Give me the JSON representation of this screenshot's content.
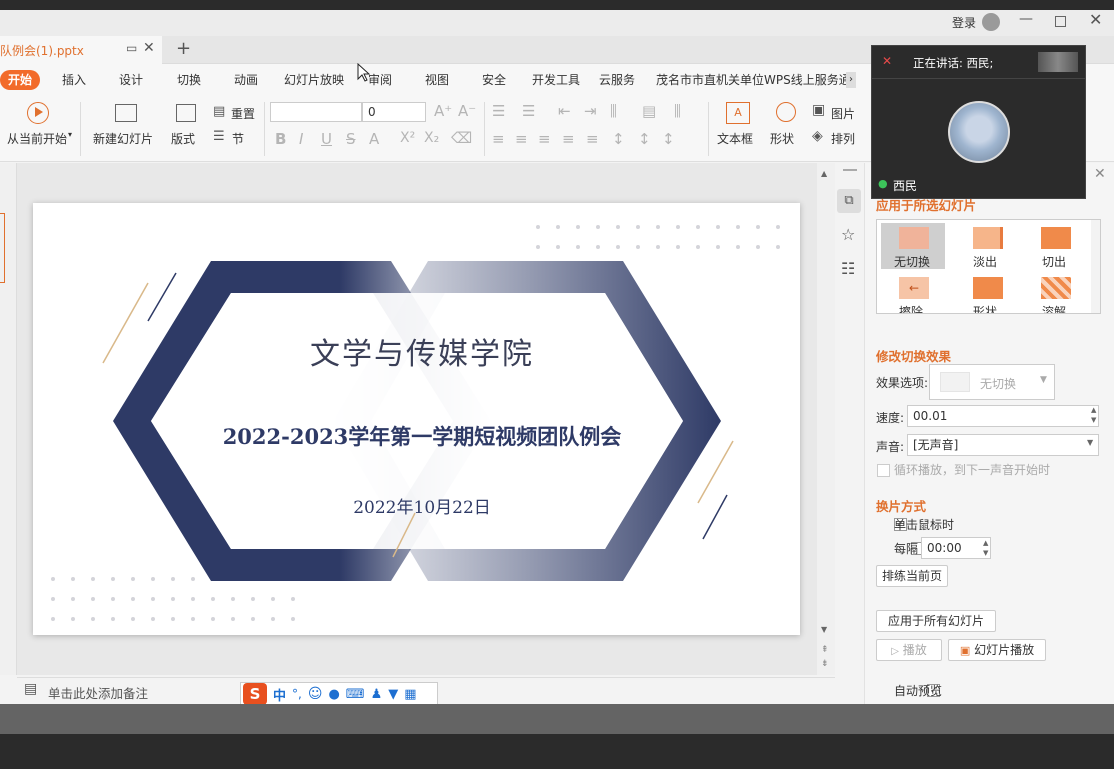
{
  "titlebar": {
    "login": "登录"
  },
  "doc_tab": {
    "title": "队例会(1).pptx"
  },
  "menu": {
    "items": [
      "开始",
      "插入",
      "设计",
      "切换",
      "动画",
      "幻灯片放映",
      "审阅",
      "视图",
      "安全",
      "开发工具",
      "云服务",
      "茂名市市直机关单位WPS线上服务通"
    ]
  },
  "ribbon": {
    "play_from_current": "从当前开始",
    "new_slide": "新建幻灯片",
    "layout": "版式",
    "reset": "重置",
    "section": "节",
    "font_size": "0",
    "textbox": "文本框",
    "shape": "形状",
    "picture": "图片",
    "arrange": "排列"
  },
  "slide": {
    "title": "文学与传媒学院",
    "subtitle": "2022-2023学年第一学期短视频团队例会",
    "date": "2022年10月22日"
  },
  "notes": {
    "placeholder": "单击此处添加备注"
  },
  "ime": {
    "mode": "中"
  },
  "meeting": {
    "speaking_label": "正在讲话: 西民;",
    "participant_name": "西民"
  },
  "pane": {
    "apply_selected_header": "应用于所选幻灯片",
    "transitions": [
      "无切换",
      "淡出",
      "切出",
      "擦除",
      "形状",
      "溶解"
    ],
    "modify_header": "修改切换效果",
    "effect_label": "效果选项:",
    "effect_value": "无切换",
    "speed_label": "速度:",
    "speed_value": "00.01",
    "sound_label": "声音:",
    "sound_value": "[无声音]",
    "loop_label": "循环播放，到下一声音开始时",
    "advance_header": "换片方式",
    "on_click_label": "单击鼠标时",
    "every_label": "每隔",
    "every_value": "00:00",
    "rehearse_button": "排练当前页",
    "apply_all_button": "应用于所有幻灯片",
    "play_button": "播放",
    "slideshow_button": "幻灯片播放",
    "autopreview_label": "自动预览"
  },
  "colors": {
    "accent": "#f26b2a",
    "navy": "#2e3a66",
    "tan": "#d9b98a"
  }
}
